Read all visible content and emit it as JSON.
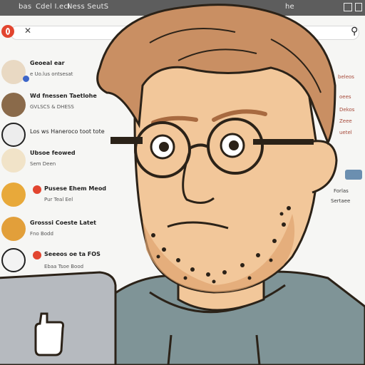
{
  "titlebar": {
    "items": [
      "bas",
      "Cdel I.ecl",
      "Ness SeutS"
    ],
    "right_label": "he"
  },
  "search": {
    "value": ""
  },
  "emails": [
    {
      "sender": "Geoeal ear",
      "subject": "e Uo.lus ontsesat"
    },
    {
      "sender": "Wd fnessen Taetlohe",
      "subject": "GVLSCS & DHESS"
    },
    {
      "sender": "Los ws Haneroco toot tote",
      "subject": ""
    },
    {
      "sender": "Ubsoe feowed",
      "subject": "Sem Deen"
    },
    {
      "sender": "Pusese Ehem Meod",
      "subject": "Pur Teal Eel"
    },
    {
      "sender": "Grosssi Coeste Latet",
      "subject": "Fno Bodd"
    },
    {
      "sender": "Seeeos oe ta FOS",
      "subject": "Ebaa Tsoe Bood"
    }
  ],
  "right_pane": {
    "lines": [
      "beleos",
      "oees",
      "Dekos",
      "Zeee",
      "uetel",
      "Forlas",
      "Sertaee"
    ]
  },
  "colors": {
    "hair": "#c98f63",
    "skin": "#f2c79a",
    "hoodie": "#7f9497",
    "lineart": "#2b2218",
    "accent": "#e2452f"
  }
}
